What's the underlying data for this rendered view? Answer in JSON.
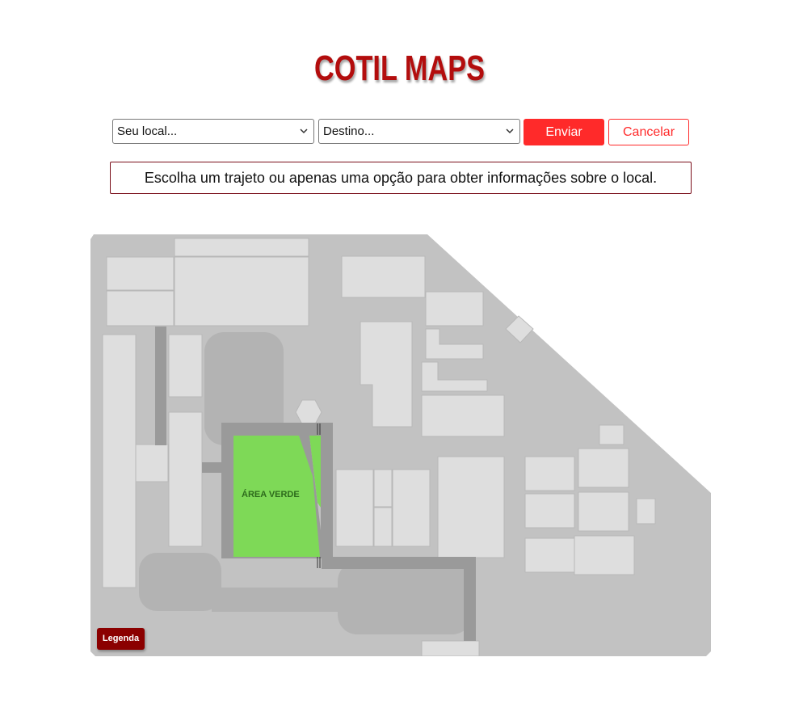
{
  "app": {
    "title": "COTIL MAPS"
  },
  "controls": {
    "origin_value": "Seu local...",
    "destination_value": "Destino...",
    "send_label": "Enviar",
    "cancel_label": "Cancelar"
  },
  "info_message": "Escolha um trajeto ou apenas uma opção para obter informações sobre o local.",
  "map": {
    "green_area_label": "ÁREA VERDE",
    "legend_label": "Legenda"
  },
  "colors": {
    "brand": "#b30d0d",
    "accent": "#ff2a2a",
    "legend": "#8b0000",
    "green_area": "#7ed957"
  }
}
